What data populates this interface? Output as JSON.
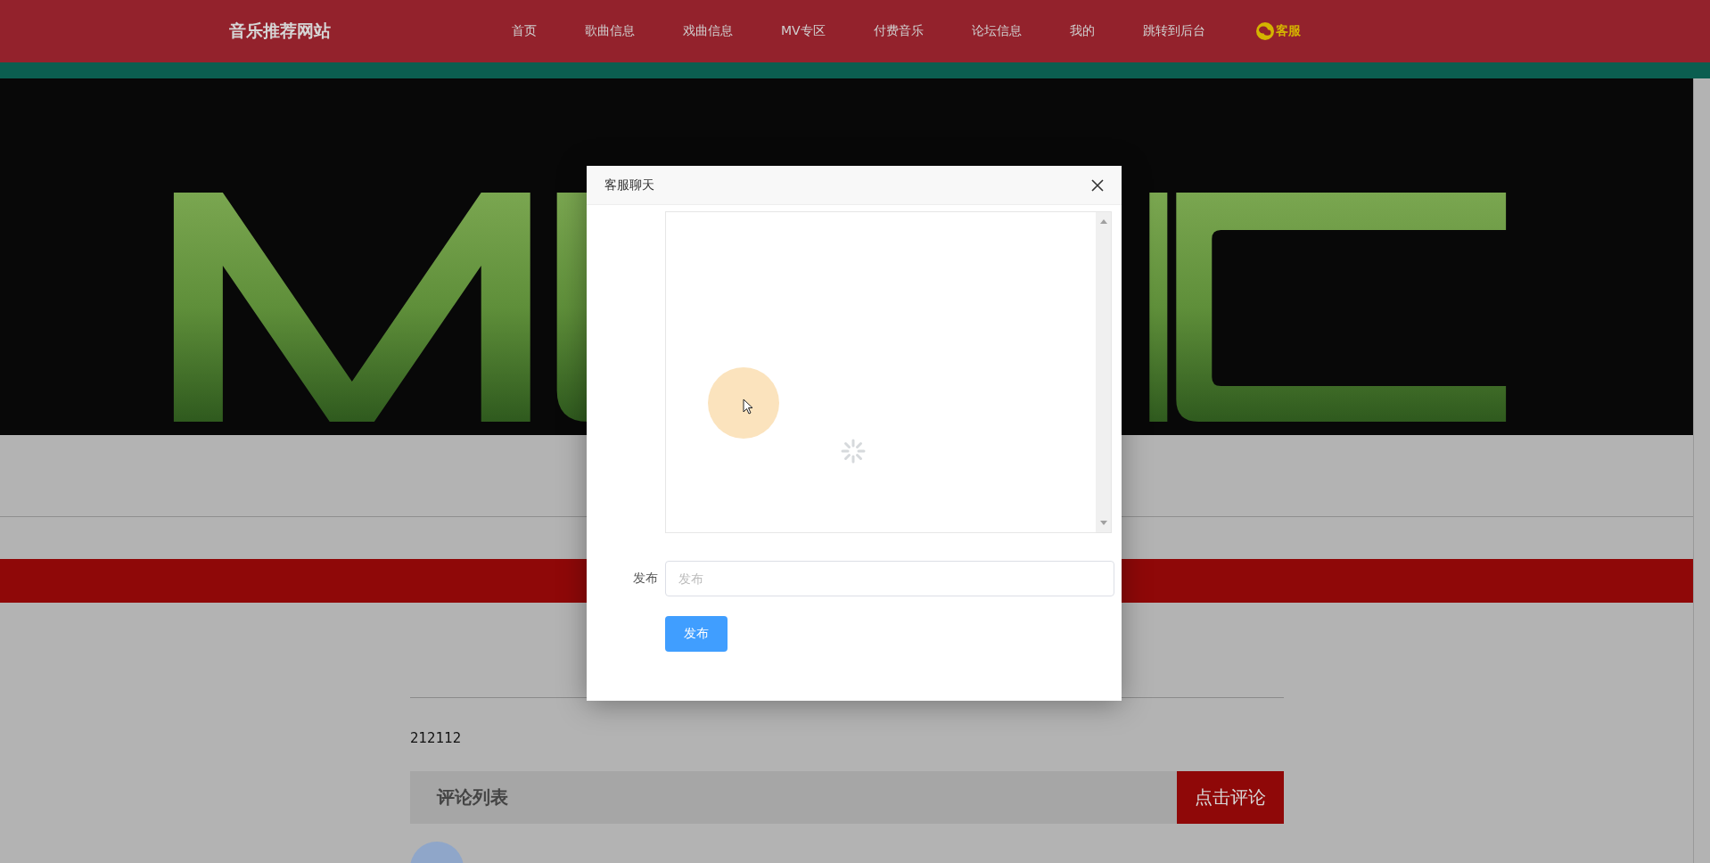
{
  "site_title": "音乐推荐网站",
  "nav": [
    {
      "label": "首页",
      "kind": "link"
    },
    {
      "label": "歌曲信息",
      "kind": "link"
    },
    {
      "label": "戏曲信息",
      "kind": "link"
    },
    {
      "label": "MV专区",
      "kind": "link"
    },
    {
      "label": "付费音乐",
      "kind": "link"
    },
    {
      "label": "论坛信息",
      "kind": "link"
    },
    {
      "label": "我的",
      "kind": "link"
    },
    {
      "label": "跳转到后台",
      "kind": "link"
    },
    {
      "label": "客服",
      "kind": "service"
    }
  ],
  "detail": {
    "text": "212112"
  },
  "comments": {
    "title": "评论列表",
    "button": "点击评论"
  },
  "dialog": {
    "title": "客服聊天",
    "message_label": "发布",
    "message_placeholder": "发布",
    "submit": "发布"
  }
}
